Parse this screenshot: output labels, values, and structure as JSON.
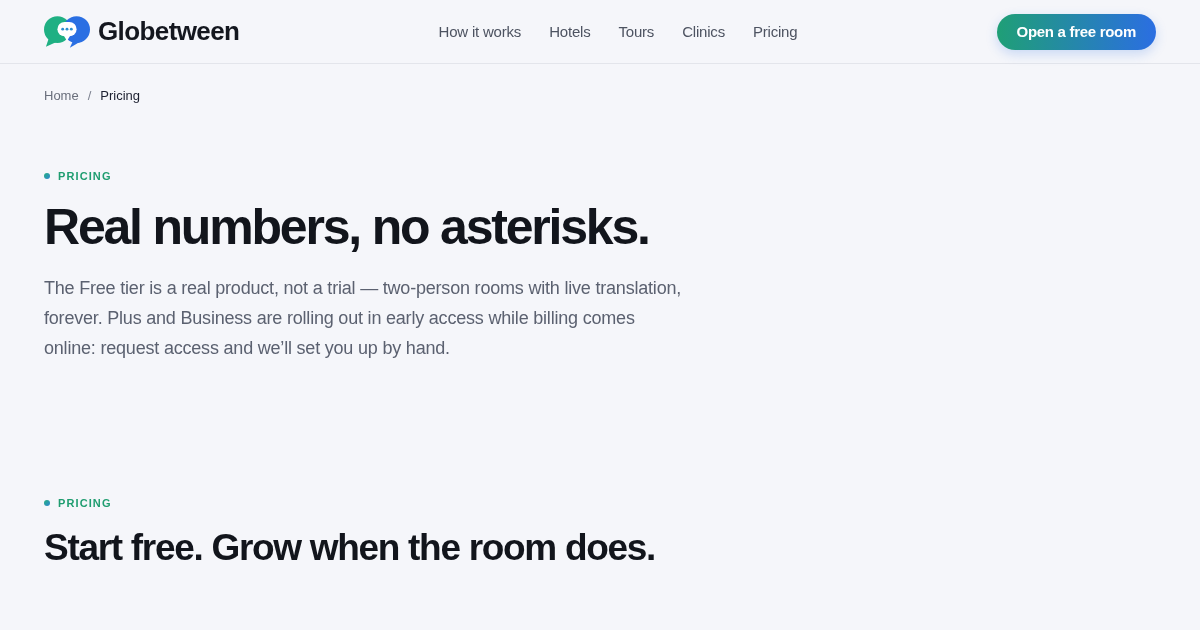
{
  "header": {
    "brand": "Globetween",
    "nav": [
      "How it works",
      "Hotels",
      "Tours",
      "Clinics",
      "Pricing"
    ],
    "cta": "Open a free room"
  },
  "breadcrumb": {
    "separator": "/",
    "items": [
      {
        "label": "Home",
        "current": false
      },
      {
        "label": "Pricing",
        "current": true
      }
    ]
  },
  "hero": {
    "eyebrow": "PRICING",
    "title": "Real numbers, no asterisks.",
    "intro": "The Free tier is a real product, not a trial — two-person rooms with live translation, forever. Plus and Business are rolling out in early access while billing comes online: request access and we’ll set you up by hand."
  },
  "section": {
    "eyebrow": "PRICING",
    "title": "Start free. Grow when the room does."
  }
}
